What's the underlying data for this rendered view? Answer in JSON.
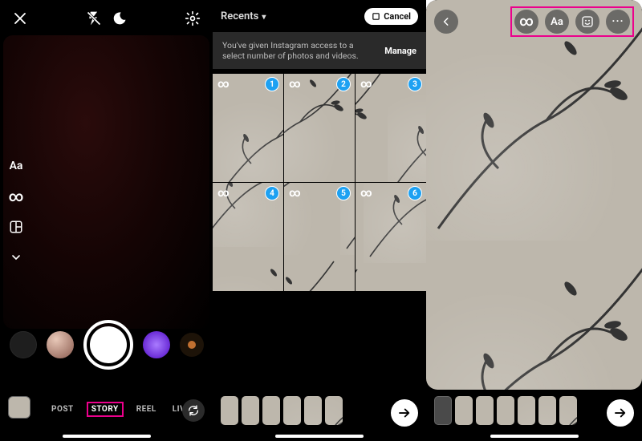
{
  "panel1": {
    "side_options": {
      "text": "Aa",
      "boomerang": "∞"
    },
    "modes": {
      "post": "POST",
      "story": "STORY",
      "reel": "REEL",
      "live": "LIVE"
    }
  },
  "panel2": {
    "recents": "Recents",
    "cancel": "Cancel",
    "notice": "You've given Instagram access to a select number of photos and videos.",
    "manage": "Manage",
    "cells": {
      "n1": "1",
      "n2": "2",
      "n3": "3",
      "n4": "4",
      "n5": "5",
      "n6": "6",
      "inf": "∞"
    }
  },
  "panel3": {
    "tools": {
      "boomerang": "∞",
      "text": "Aa",
      "more": "··· "
    }
  }
}
